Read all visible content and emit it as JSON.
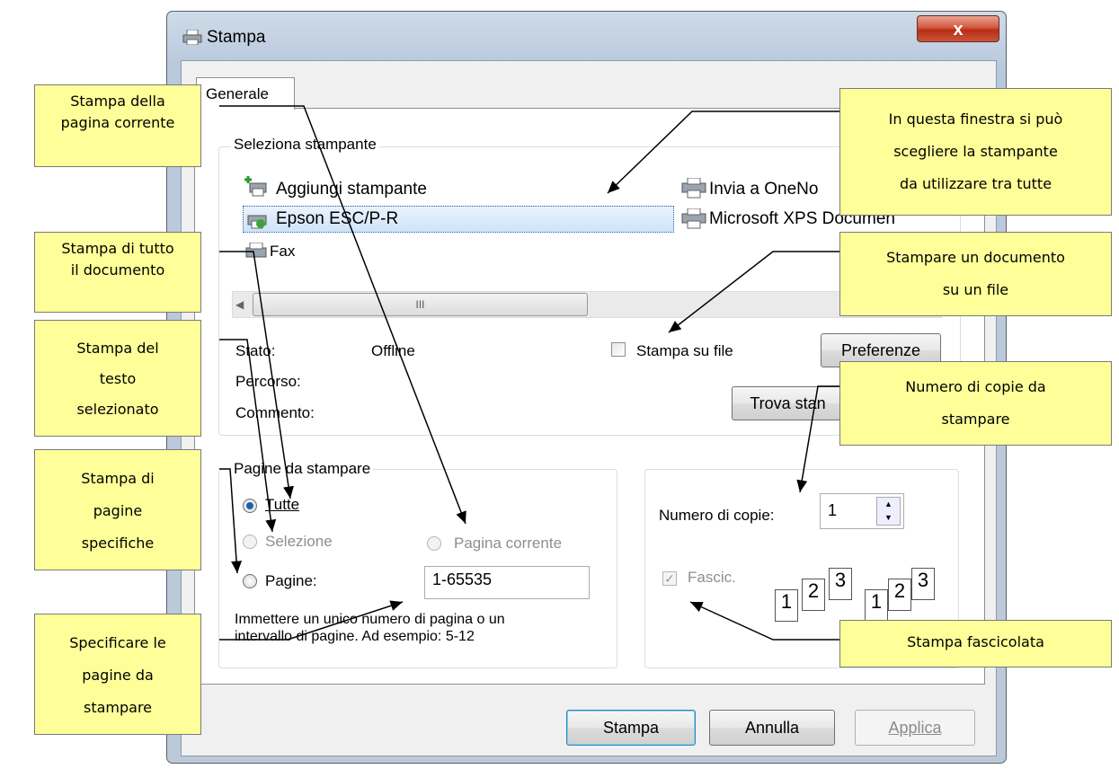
{
  "window": {
    "title": "Stampa",
    "close_label": "x"
  },
  "tabs": [
    {
      "label": "Generale"
    }
  ],
  "select_printer": {
    "legend": "Seleziona stampante",
    "printers": [
      {
        "label": "Aggiungi stampante"
      },
      {
        "label": "Epson ESC/P-R",
        "selected": true
      },
      {
        "label": "Fax"
      },
      {
        "label": "Invia a OneNo"
      },
      {
        "label": "Microsoft XPS Documen"
      }
    ],
    "scroll_thumb": "III",
    "status_label": "Stato:",
    "status_value": "Offline",
    "path_label": "Percorso:",
    "comment_label": "Commento:",
    "print_to_file_label": "Stampa su file",
    "preferences_button": "Preferenze",
    "find_printer_button": "Trova stan"
  },
  "page_range": {
    "legend": "Pagine da stampare",
    "all_label": "Tutte",
    "selection_label": "Selezione",
    "current_page_label": "Pagina corrente",
    "pages_label": "Pagine:",
    "pages_value": "1-65535",
    "hint_line1": "Immettere un unico numero di pagina o un",
    "hint_line2": "intervallo di pagine. Ad esempio: 5-12"
  },
  "copies": {
    "label": "Numero di copie:",
    "value": "1",
    "collate_label": "Fascic.",
    "collate_icon_digits": [
      "1",
      "2",
      "3"
    ]
  },
  "buttons": {
    "print": "Stampa",
    "cancel": "Annulla",
    "apply": "Applica"
  },
  "callouts": {
    "current_page": [
      "Stampa della",
      "pagina corrente"
    ],
    "all_document": [
      "Stampa di tutto",
      "il documento"
    ],
    "selected_text": [
      "Stampa del",
      "testo",
      "selezionato"
    ],
    "specific_pages": [
      "Stampa di",
      "pagine",
      "specifiche"
    ],
    "specify_pages": [
      "Specificare le",
      "pagine da",
      "stampare"
    ],
    "choose_printer": [
      "In questa finestra si può",
      "scegliere la stampante",
      "da utilizzare tra tutte"
    ],
    "print_to_file": [
      "Stampare un documento",
      "su un file"
    ],
    "copies_number": [
      "Numero di copie da",
      "stampare"
    ],
    "collated": [
      "Stampa fascicolata"
    ]
  },
  "colors": {
    "callout_bg": "#ffff99",
    "selection_bg": "#cfe3f9",
    "close_btn": "#c8543a"
  }
}
